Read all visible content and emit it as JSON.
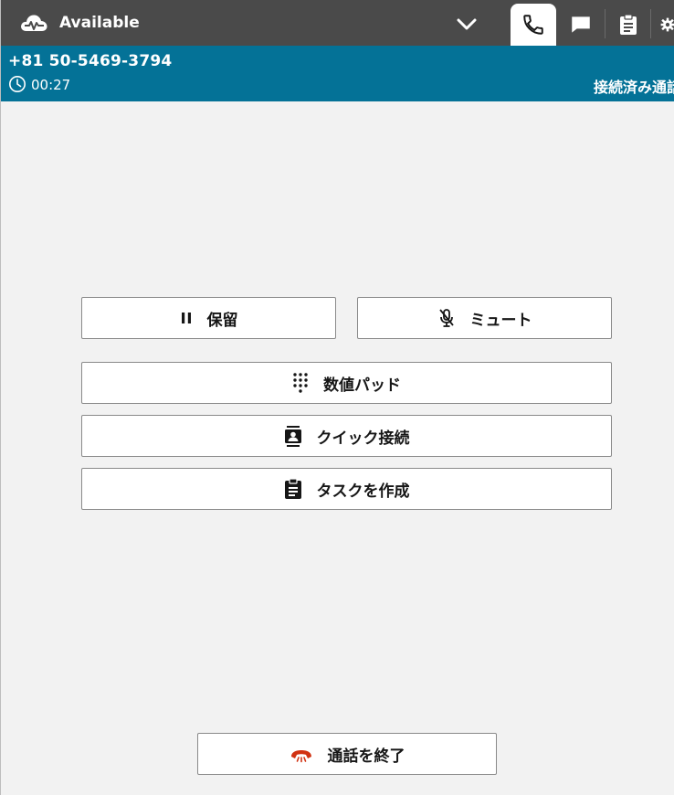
{
  "topbar": {
    "status_label": "Available",
    "status_icon": "cloud-heartbeat-icon",
    "tabs": [
      {
        "name": "phone",
        "icon": "phone-icon",
        "active": true
      },
      {
        "name": "chat",
        "icon": "chat-icon",
        "active": false
      },
      {
        "name": "tasks",
        "icon": "clipboard-icon",
        "active": false
      },
      {
        "name": "settings",
        "icon": "gear-icon",
        "active": false
      }
    ]
  },
  "call": {
    "phone_number": "+81 50-5469-3794",
    "timer": "00:27",
    "status": "接続済み通話"
  },
  "actions": {
    "hold_label": "保留",
    "mute_label": "ミュート",
    "dialpad_label": "数値パッド",
    "quick_connect_label": "クイック接続",
    "create_task_label": "タスクを作成",
    "end_call_label": "通話を終了"
  },
  "colors": {
    "topbar_bg": "#4a4a4a",
    "callbar_bg": "#047297",
    "page_bg": "#f2f2f2",
    "end_call_icon": "#d13212"
  }
}
